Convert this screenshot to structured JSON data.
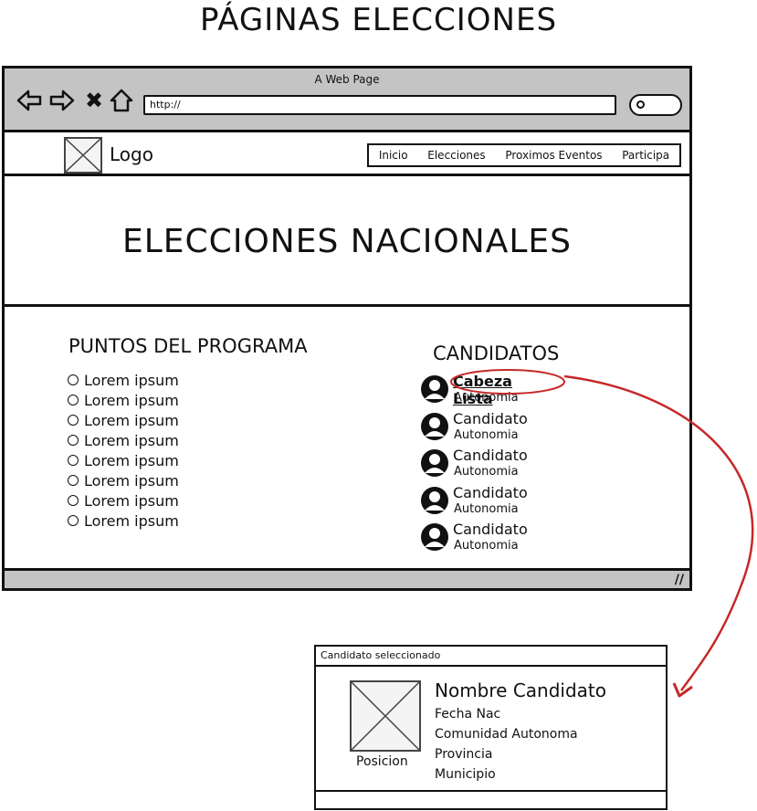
{
  "page_title": "PÁGINAS ELECCIONES",
  "browser": {
    "window_title": "A Web Page",
    "url": "http://",
    "back_icon": "arrow-left-icon",
    "forward_icon": "arrow-right-icon",
    "stop_icon": "close-icon",
    "home_icon": "home-icon",
    "search_icon": "search-icon"
  },
  "header": {
    "logo_label": "Logo",
    "nav": [
      "Inicio",
      "Elecciones",
      "Proximos Eventos",
      "Participa"
    ]
  },
  "hero": {
    "title": "ELECCIONES NACIONALES"
  },
  "programa": {
    "title": "PUNTOS DEL PROGRAMA",
    "items": [
      "Lorem ipsum",
      "Lorem ipsum",
      "Lorem ipsum",
      "Lorem ipsum",
      "Lorem ipsum",
      "Lorem ipsum",
      "Lorem ipsum",
      "Lorem ipsum"
    ]
  },
  "candidatos": {
    "title": "CANDIDATOS",
    "items": [
      {
        "name": "Cabeza Lista",
        "sub": "Autonomia"
      },
      {
        "name": "Candidato",
        "sub": "Autonomia"
      },
      {
        "name": "Candidato",
        "sub": "Autonomia"
      },
      {
        "name": "Candidato",
        "sub": "Autonomia"
      },
      {
        "name": "Candidato",
        "sub": "Autonomia"
      }
    ]
  },
  "popup": {
    "title": "Candidato seleccionado",
    "name": "Nombre Candidato",
    "posicion": "Posicion",
    "fields": [
      "Fecha Nac",
      "Comunidad Autonoma",
      "Provincia",
      "Municipio"
    ]
  },
  "colors": {
    "annotation": "#c62828",
    "chrome": "#c4c4c4"
  }
}
